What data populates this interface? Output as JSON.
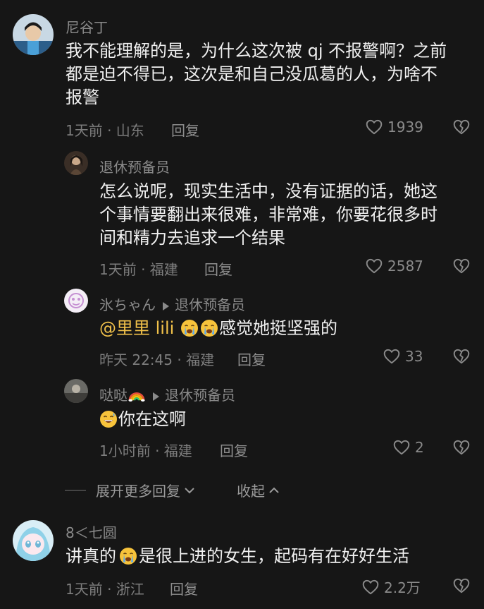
{
  "comments": [
    {
      "name": "尼谷丁",
      "lines": [
        "我不能理解的是，为什么这次被 qj 不报警啊？之前",
        "都是迫不得已，这次是和自己没瓜葛的人，为啥不",
        "报警"
      ],
      "meta": "1天前 · 山东",
      "reply_label": "回复",
      "likes": "1939"
    },
    {
      "name": "退休预备员",
      "lines": [
        "怎么说呢，现实生活中，没有证据的话，她这",
        "个事情要翻出来很难，非常难，你要花很多时",
        "间和精力去追求一个结果"
      ],
      "meta": "1天前 · 福建",
      "reply_label": "回复",
      "likes": "2587"
    },
    {
      "name": "氷ちゃん",
      "reply_to": "退休预备员",
      "mention": "@里里 lili",
      "text": "感觉她挺坚强的",
      "meta": "昨天 22:45 · 福建",
      "reply_label": "回复",
      "likes": "33"
    },
    {
      "name": "哒哒",
      "reply_to": "退休预备员",
      "text": "你在这啊",
      "meta": "1小时前 · 福建",
      "reply_label": "回复",
      "likes": "2"
    },
    {
      "name": "8＜七圆",
      "text_before": "讲真的",
      "text_after": "是很上进的女生，起码有在好好生活",
      "meta": "1天前 · 浙江",
      "reply_label": "回复",
      "likes": "2.2万"
    }
  ],
  "thread": {
    "expand_label": "展开更多回复",
    "collapse_label": "收起"
  },
  "colors": {
    "background": "#161616",
    "mention": "#f1c14a",
    "muted": "#8a8a8a"
  },
  "icons": [
    "heart-icon",
    "dislike-icon",
    "chevron-down-icon",
    "chevron-up-icon",
    "rainbow-emoji",
    "crying-emoji",
    "grin-emoji"
  ]
}
